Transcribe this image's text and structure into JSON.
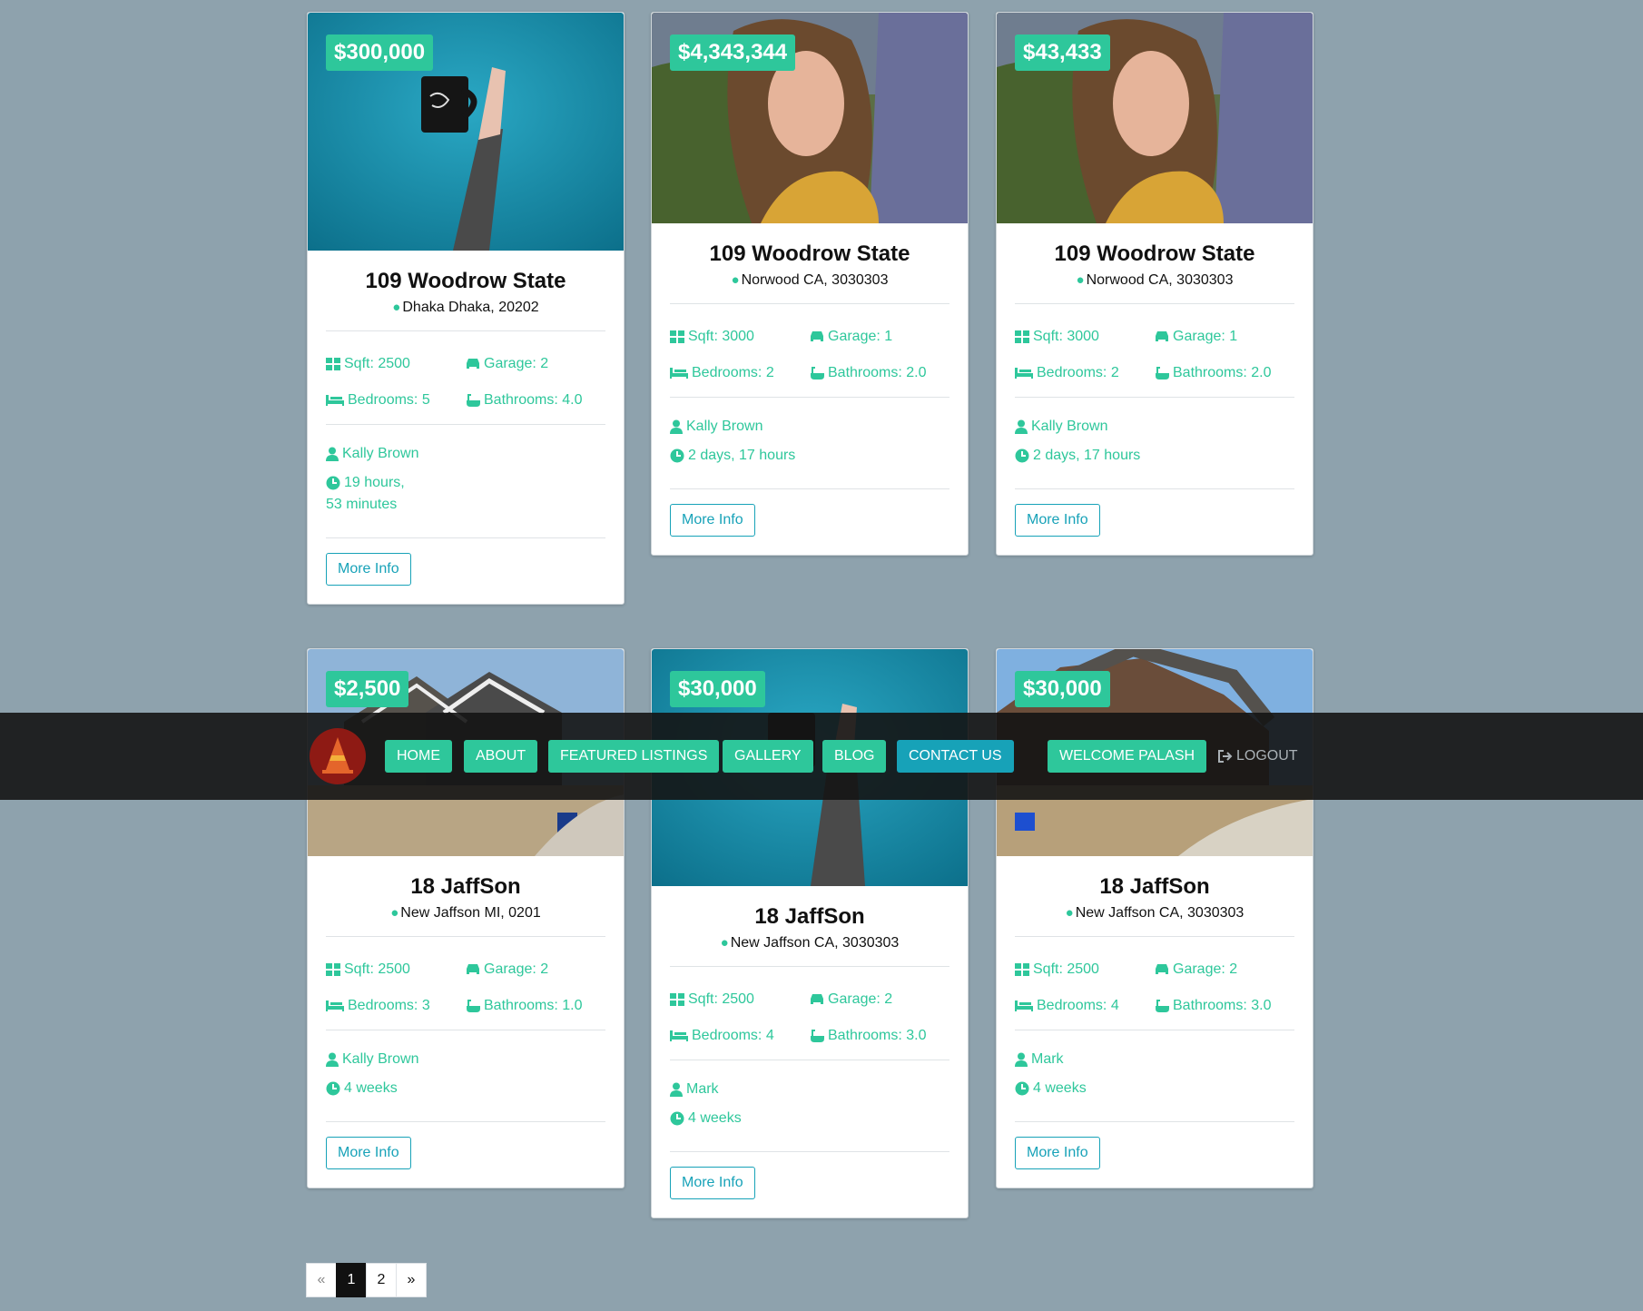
{
  "listings": [
    {
      "price": "$300,000",
      "title": "109 Woodrow State",
      "location": "Dhaka Dhaka, 20202",
      "sqft": "Sqft: 2500",
      "garage": "Garage: 2",
      "bedrooms": "Bedrooms: 5",
      "bathrooms": "Bathrooms: 4.0",
      "agent": "Kally Brown",
      "time": "19 hours, 53 minutes",
      "button": "More Info",
      "image": "mug-on-teal"
    },
    {
      "price": "$4,343,344",
      "title": "109 Woodrow State",
      "location": "Norwood CA, 3030303",
      "sqft": "Sqft: 3000",
      "garage": "Garage: 1",
      "bedrooms": "Bedrooms: 2",
      "bathrooms": "Bathrooms: 2.0",
      "agent": "Kally Brown",
      "time": "2 days, 17 hours",
      "button": "More Info",
      "image": "woman-in-lavender"
    },
    {
      "price": "$43,433",
      "title": "109 Woodrow State",
      "location": "Norwood CA, 3030303",
      "sqft": "Sqft: 3000",
      "garage": "Garage: 1",
      "bedrooms": "Bedrooms: 2",
      "bathrooms": "Bathrooms: 2.0",
      "agent": "Kally Brown",
      "time": "2 days, 17 hours",
      "button": "More Info",
      "image": "woman-in-lavender"
    },
    {
      "price": "$2,500",
      "title": "18 JaffSon",
      "location": "New Jaffson MI, 0201",
      "sqft": "Sqft: 2500",
      "garage": "Garage: 2",
      "bedrooms": "Bedrooms: 3",
      "bathrooms": "Bathrooms: 1.0",
      "agent": "Kally Brown",
      "time": "4 weeks",
      "button": "More Info",
      "image": "house-front"
    },
    {
      "price": "$30,000",
      "title": "18 JaffSon",
      "location": "New Jaffson CA, 3030303",
      "sqft": "Sqft: 2500",
      "garage": "Garage: 2",
      "bedrooms": "Bedrooms: 4",
      "bathrooms": "Bathrooms: 3.0",
      "agent": "Mark",
      "time": "4 weeks",
      "button": "More Info",
      "image": "mug-on-teal"
    },
    {
      "price": "$30,000",
      "title": "18 JaffSon",
      "location": "New Jaffson CA, 3030303",
      "sqft": "Sqft: 2500",
      "garage": "Garage: 2",
      "bedrooms": "Bedrooms: 4",
      "bathrooms": "Bathrooms: 3.0",
      "agent": "Mark",
      "time": "4 weeks",
      "button": "More Info",
      "image": "house-side"
    }
  ],
  "nav": {
    "items": [
      "HOME",
      "ABOUT",
      "FEATURED LISTINGS",
      "GALLERY",
      "BLOG",
      "CONTACT US"
    ],
    "welcome": "WELCOME PALASH",
    "logout": "LOGOUT"
  },
  "pagination": {
    "prev": "«",
    "pages": [
      "1",
      "2"
    ],
    "next": "»",
    "active": "1"
  },
  "colors": {
    "accent": "#2ec79b",
    "info": "#17a2b8",
    "background": "#8ea2ad",
    "navbar": "#141414"
  }
}
